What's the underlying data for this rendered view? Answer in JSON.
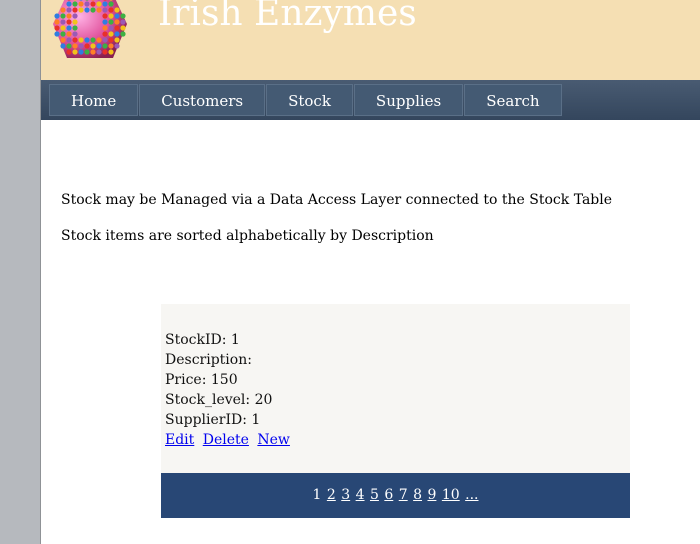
{
  "header": {
    "site_title": "Irish Enzymes"
  },
  "nav": [
    {
      "label": "Home"
    },
    {
      "label": "Customers"
    },
    {
      "label": "Stock"
    },
    {
      "label": "Supplies"
    },
    {
      "label": "Search"
    }
  ],
  "intro": {
    "line1": "Stock may be Managed via a Data Access Layer connected to the Stock Table",
    "line2": "Stock items are sorted alphabetically by Description"
  },
  "record": {
    "stockid": "StockID: 1",
    "description": "Description:",
    "price": "Price: 150",
    "stock_level": "Stock_level: 20",
    "supplierid": "SupplierID: 1",
    "actions": {
      "edit": "Edit",
      "delete": "Delete",
      "new": "New"
    }
  },
  "pager": {
    "current": "1",
    "pages": [
      "2",
      "3",
      "4",
      "5",
      "6",
      "7",
      "8",
      "9",
      "10",
      "..."
    ]
  },
  "colors": {
    "header_bg": "#f5dfb3",
    "nav_bg": "#3e5068",
    "pager_bg": "#284775",
    "record_bg": "#f7f6f3",
    "link": "#0000ee"
  }
}
